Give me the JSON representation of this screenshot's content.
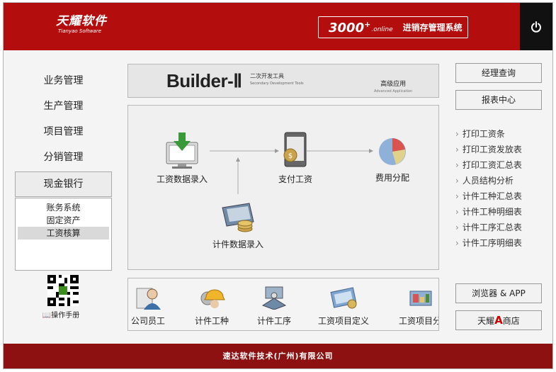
{
  "header": {
    "logo_cn": "天耀软件",
    "logo_en": "Tianyao Software",
    "product_version": "3000",
    "product_plus": "+",
    "product_online": "online",
    "product_name": "进销存管理系统",
    "power_icon": "power-icon"
  },
  "nav": {
    "items": [
      {
        "label": "业务管理"
      },
      {
        "label": "生产管理"
      },
      {
        "label": "项目管理"
      },
      {
        "label": "分销管理"
      },
      {
        "label": "现金银行"
      }
    ],
    "active_index": 4,
    "sub_items": [
      {
        "label": "账务系统"
      },
      {
        "label": "固定资产"
      },
      {
        "label": "工资核算"
      }
    ],
    "sub_selected_index": 2,
    "qr_label": "操作手册"
  },
  "banner": {
    "title": "Builder-Ⅱ",
    "sub_cn": "二次开发工具",
    "sub_en": "Secondary Development Tools",
    "adv_cn": "高级应用",
    "adv_en": "Advanced Application"
  },
  "flow": {
    "nodes": [
      {
        "label": "工资数据录入",
        "icon": "salary-entry-icon"
      },
      {
        "label": "支付工资",
        "icon": "pay-salary-icon"
      },
      {
        "label": "费用分配",
        "icon": "pie-chart-icon"
      },
      {
        "label": "计件数据录入",
        "icon": "piecework-entry-icon"
      }
    ]
  },
  "toolbar": {
    "items": [
      {
        "label": "公司员工",
        "icon": "employee-icon"
      },
      {
        "label": "计件工种",
        "icon": "worker-helmet-icon"
      },
      {
        "label": "计件工序",
        "icon": "process-icon"
      },
      {
        "label": "工资项目定义",
        "icon": "salary-item-icon"
      },
      {
        "label": "工资项目分",
        "icon": "salary-item-alloc-icon"
      }
    ]
  },
  "right": {
    "manager_query": "经理查询",
    "report_center": "报表中心",
    "reports": [
      "打印工资条",
      "打印工资发放表",
      "打印工资汇总表",
      "人员结构分析",
      "计件工种汇总表",
      "计件工种明细表",
      "计件工序汇总表",
      "计件工序明细表"
    ],
    "browser_app": "浏览器 & APP",
    "store_prefix": "天耀",
    "store_a": "A",
    "store_suffix": "商店"
  },
  "footer": {
    "company": "速达软件技术(广州)有限公司"
  },
  "colors": {
    "header_red": "#b30d0d",
    "footer_red": "#8e1111",
    "power_bg": "#111111"
  }
}
